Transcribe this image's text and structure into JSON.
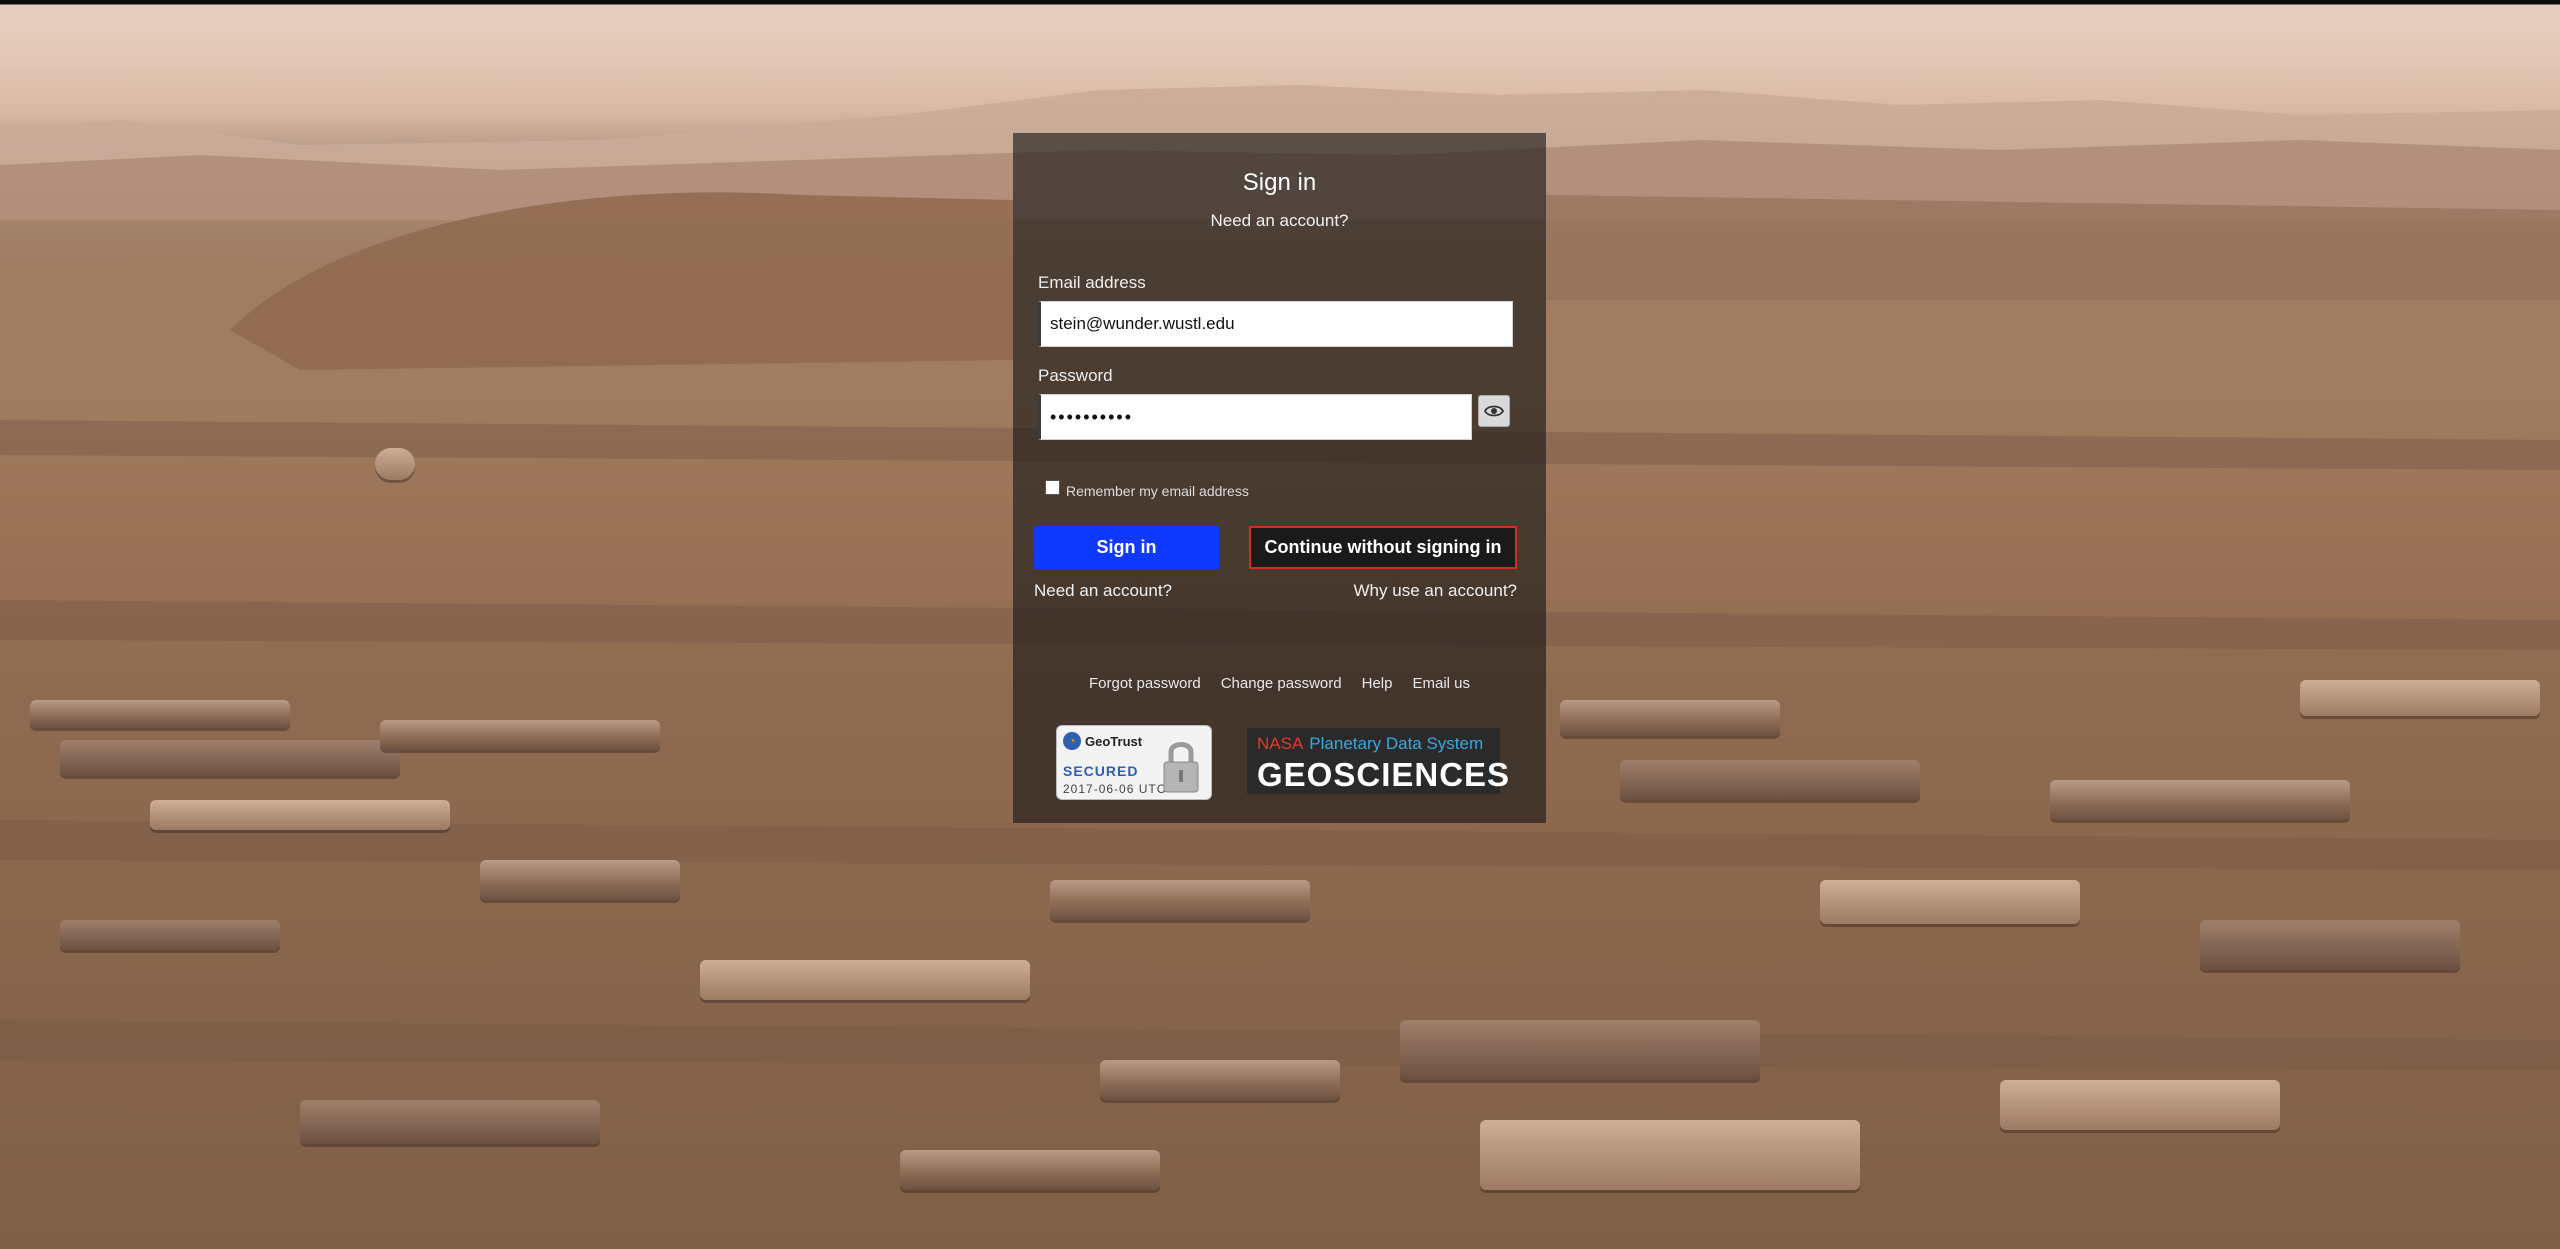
{
  "signin": {
    "title": "Sign in",
    "need_account_top": "Need an account?",
    "email_label": "Email address",
    "email_value": "stein@wunder.wustl.edu",
    "password_label": "Password",
    "password_value": "••••••••••",
    "remember_label": "Remember my email address",
    "signin_button": "Sign in",
    "continue_button": "Continue without signing in",
    "need_account_link": "Need an account?",
    "why_account_link": "Why use an account?"
  },
  "footer": {
    "links": [
      "Forgot password",
      "Change password",
      "Help",
      "Email us"
    ]
  },
  "badges": {
    "geotrust_brand": "GeoTrust",
    "geotrust_secured": "SECURED",
    "geotrust_date": "2017-06-06 UTC",
    "pds_nasa": "NASA",
    "pds_name": "Planetary Data System",
    "pds_geo": "GEOSCIENCES"
  },
  "colors": {
    "signin_button_bg": "#0f39ff",
    "continue_button_border": "#d1301f",
    "panel_bg": "rgba(22,22,22,0.62)"
  },
  "icons": {
    "show_password": "eye-icon",
    "geotrust_lock": "lock-icon"
  }
}
